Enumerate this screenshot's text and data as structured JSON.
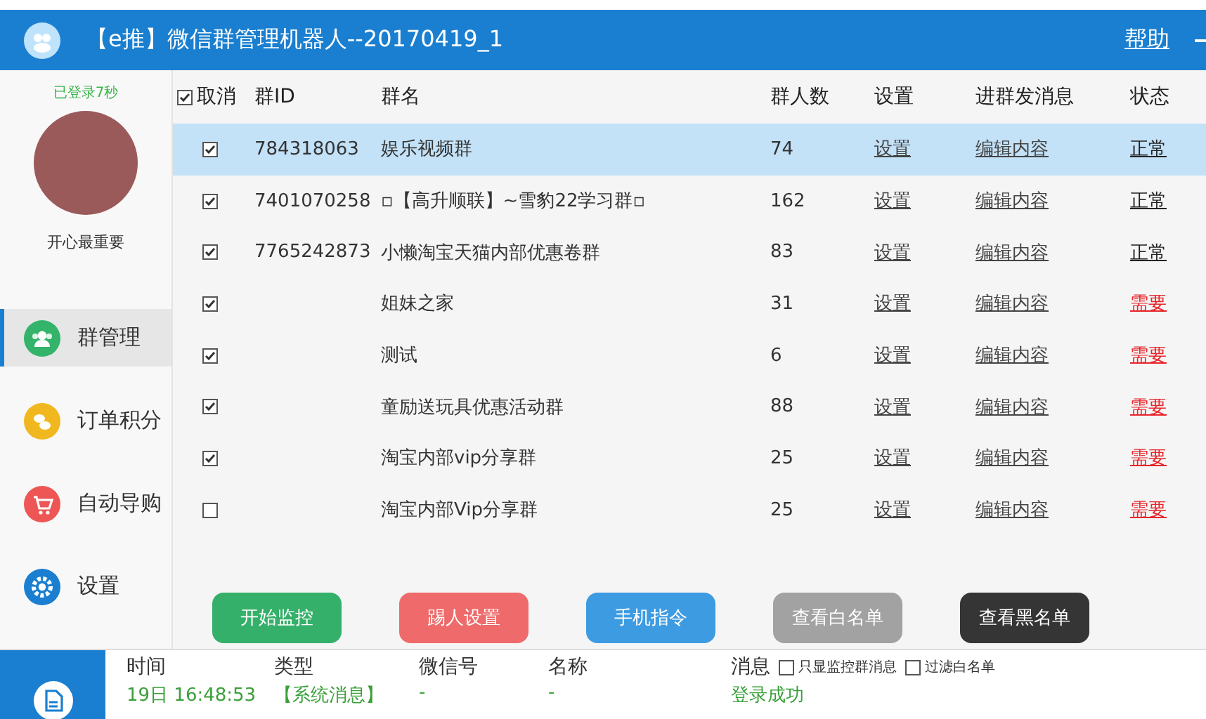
{
  "window": {
    "title": "【e推】微信群管理机器人--20170419_1",
    "help": "帮助"
  },
  "profile": {
    "login_status": "已登录7秒",
    "nickname": "开心最重要"
  },
  "sidebar": {
    "items": [
      {
        "label": "群管理",
        "selected": true
      },
      {
        "label": "订单积分",
        "selected": false
      },
      {
        "label": "自动导购",
        "selected": false
      },
      {
        "label": "设置",
        "selected": false
      }
    ]
  },
  "table": {
    "select_all": {
      "label": "取消",
      "checked": true
    },
    "columns": [
      "群ID",
      "群名",
      "群人数",
      "设置",
      "进群发消息",
      "状态"
    ],
    "rows": [
      {
        "checked": true,
        "selected": true,
        "id": "784318063",
        "name": "娱乐视频群",
        "count": "74",
        "settings": "设置",
        "message": "编辑内容",
        "status": {
          "label": "正常",
          "color": "#222222"
        }
      },
      {
        "checked": true,
        "selected": false,
        "id": "7401070258",
        "name": "▫【高升顺联】~雪豹22学习群▫",
        "count": "162",
        "settings": "设置",
        "message": "编辑内容",
        "status": {
          "label": "正常",
          "color": "#222222"
        }
      },
      {
        "checked": true,
        "selected": false,
        "id": "7765242873",
        "name": "小懒淘宝天猫内部优惠卷群",
        "count": "83",
        "settings": "设置",
        "message": "编辑内容",
        "status": {
          "label": "正常",
          "color": "#222222"
        }
      },
      {
        "checked": true,
        "selected": false,
        "name": "姐妹之家",
        "count": "31",
        "settings": "设置",
        "message": "编辑内容",
        "status": {
          "label": "需要",
          "color": "#e8262c"
        }
      },
      {
        "checked": true,
        "selected": false,
        "name": "测试",
        "count": "6",
        "settings": "设置",
        "message": "编辑内容",
        "status": {
          "label": "需要",
          "color": "#e8262c"
        }
      },
      {
        "checked": true,
        "selected": false,
        "name": "童励送玩具优惠活动群",
        "count": "88",
        "settings": "设置",
        "message": "编辑内容",
        "status": {
          "label": "需要",
          "color": "#e8262c"
        }
      },
      {
        "checked": true,
        "selected": false,
        "name": "淘宝内部vip分享群",
        "count": "25",
        "settings": "设置",
        "message": "编辑内容",
        "status": {
          "label": "需要",
          "color": "#e8262c"
        }
      },
      {
        "checked": false,
        "selected": false,
        "name": "淘宝内部Vip分享群",
        "count": "25",
        "settings": "设置",
        "message": "编辑内容",
        "status": {
          "label": "需要",
          "color": "#e8262c"
        }
      }
    ]
  },
  "buttons": [
    {
      "label": "开始监控",
      "color": "#35b06a"
    },
    {
      "label": "踢人设置",
      "color": "#ef6a6a"
    },
    {
      "label": "手机指令",
      "color": "#3d9be2"
    },
    {
      "label": "查看白名单",
      "color": "#a2a2a2"
    },
    {
      "label": "查看黑名单",
      "color": "#353535"
    }
  ],
  "log": {
    "columns": [
      "时间",
      "类型",
      "微信号",
      "名称",
      "消息"
    ],
    "filters": [
      {
        "label": "只显监控群消息",
        "checked": false
      },
      {
        "label": "过滤白名单",
        "checked": false
      }
    ],
    "rows": [
      {
        "time": "19日 16:48:53",
        "type": "【系统消息】",
        "wechat_id": "-",
        "name": "-",
        "message": "登录成功"
      }
    ]
  }
}
